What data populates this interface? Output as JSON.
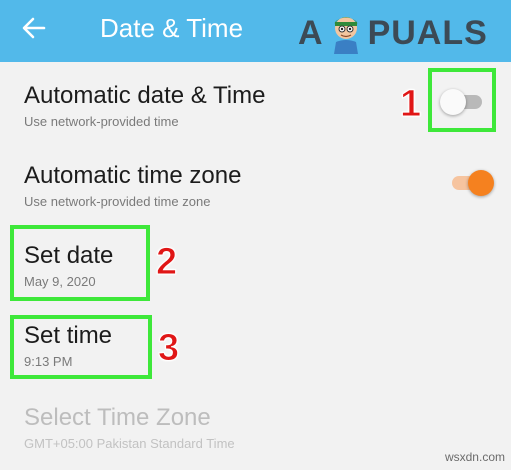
{
  "appbar": {
    "title": "Date & Time",
    "back_icon": "arrow-left-icon",
    "background": "#52b9ea"
  },
  "watermark": {
    "brand_left": "A",
    "brand_right": "PUALS",
    "site": "wsxdn.com"
  },
  "settings": [
    {
      "title": "Automatic date & Time",
      "subtitle": "Use network-provided time",
      "toggle": "off"
    },
    {
      "title": "Automatic time zone",
      "subtitle": "Use network-provided time zone",
      "toggle": "on"
    },
    {
      "title": "Set date",
      "subtitle": "May 9, 2020"
    },
    {
      "title": "Set time",
      "subtitle": "9:13 PM"
    },
    {
      "title": "Select Time Zone",
      "subtitle": "GMT+05:00 Pakistan Standard Time",
      "disabled": true
    }
  ],
  "annotations": [
    {
      "number": "1",
      "target": "Automatic date & Time toggle"
    },
    {
      "number": "2",
      "target": "Set date"
    },
    {
      "number": "3",
      "target": "Set time"
    }
  ],
  "colors": {
    "highlight": "#3ee83a",
    "number": "#e01616",
    "toggle_on": "#f5811f"
  }
}
